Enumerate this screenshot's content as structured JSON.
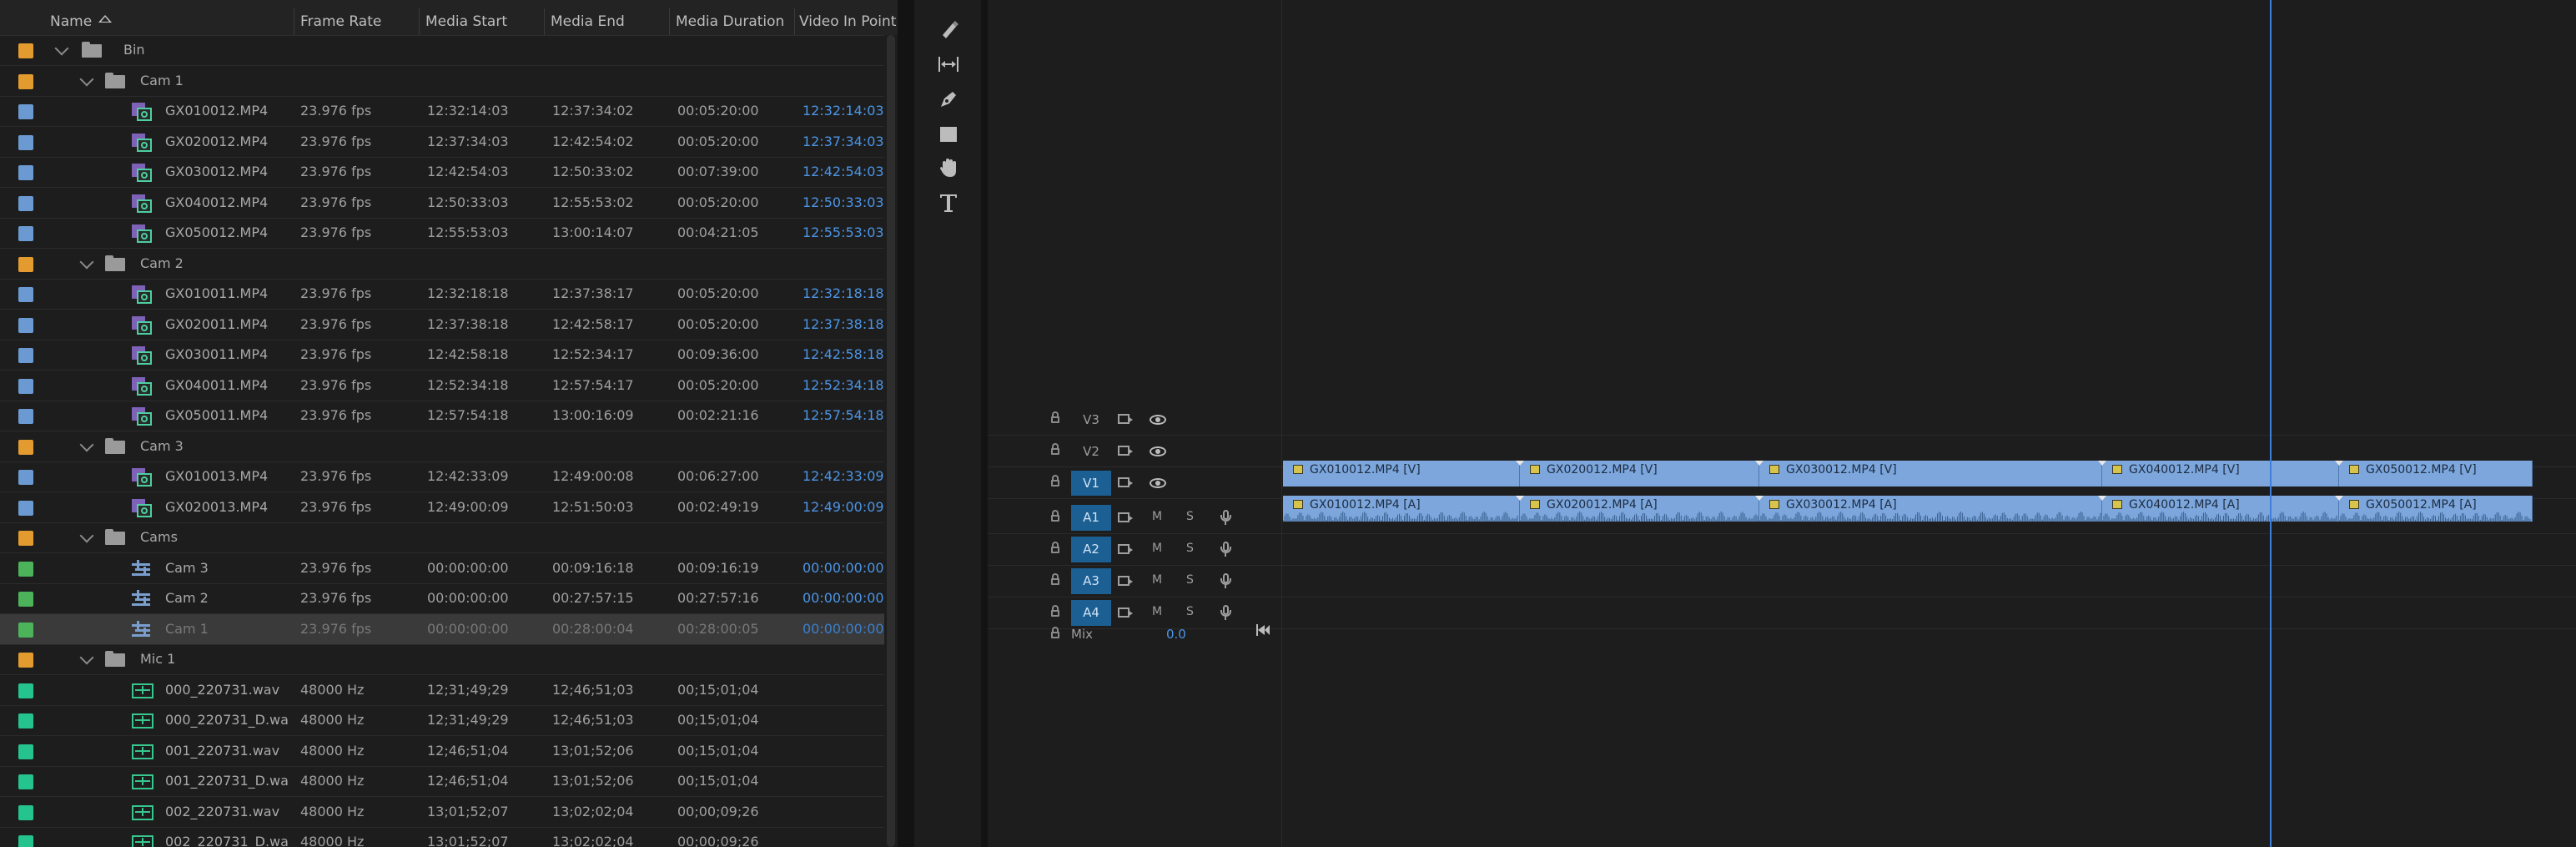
{
  "project": {
    "columns": {
      "name": "Name",
      "frame_rate": "Frame Rate",
      "media_start": "Media Start",
      "media_end": "Media End",
      "media_duration": "Media Duration",
      "video_in_point": "Video In Point"
    },
    "rows": [
      {
        "type": "folder",
        "level": 0,
        "name": "Bin",
        "label_color": "#e39b2f"
      },
      {
        "type": "folder",
        "level": 1,
        "name": "Cam 1",
        "label_color": "#e39b2f"
      },
      {
        "type": "clip",
        "level": 2,
        "name": "GX010012.MP4",
        "fr": "23.976 fps",
        "ms": "12:32:14:03",
        "me": "12:37:34:02",
        "md": "00:05:20:00",
        "vin": "12:32:14:03",
        "label_color": "#6b9ad3"
      },
      {
        "type": "clip",
        "level": 2,
        "name": "GX020012.MP4",
        "fr": "23.976 fps",
        "ms": "12:37:34:03",
        "me": "12:42:54:02",
        "md": "00:05:20:00",
        "vin": "12:37:34:03",
        "label_color": "#6b9ad3"
      },
      {
        "type": "clip",
        "level": 2,
        "name": "GX030012.MP4",
        "fr": "23.976 fps",
        "ms": "12:42:54:03",
        "me": "12:50:33:02",
        "md": "00:07:39:00",
        "vin": "12:42:54:03",
        "label_color": "#6b9ad3"
      },
      {
        "type": "clip",
        "level": 2,
        "name": "GX040012.MP4",
        "fr": "23.976 fps",
        "ms": "12:50:33:03",
        "me": "12:55:53:02",
        "md": "00:05:20:00",
        "vin": "12:50:33:03",
        "label_color": "#6b9ad3"
      },
      {
        "type": "clip",
        "level": 2,
        "name": "GX050012.MP4",
        "fr": "23.976 fps",
        "ms": "12:55:53:03",
        "me": "13:00:14:07",
        "md": "00:04:21:05",
        "vin": "12:55:53:03",
        "label_color": "#6b9ad3"
      },
      {
        "type": "folder",
        "level": 1,
        "name": "Cam 2",
        "label_color": "#e39b2f"
      },
      {
        "type": "clip",
        "level": 2,
        "name": "GX010011.MP4",
        "fr": "23.976 fps",
        "ms": "12:32:18:18",
        "me": "12:37:38:17",
        "md": "00:05:20:00",
        "vin": "12:32:18:18",
        "label_color": "#6b9ad3"
      },
      {
        "type": "clip",
        "level": 2,
        "name": "GX020011.MP4",
        "fr": "23.976 fps",
        "ms": "12:37:38:18",
        "me": "12:42:58:17",
        "md": "00:05:20:00",
        "vin": "12:37:38:18",
        "label_color": "#6b9ad3"
      },
      {
        "type": "clip",
        "level": 2,
        "name": "GX030011.MP4",
        "fr": "23.976 fps",
        "ms": "12:42:58:18",
        "me": "12:52:34:17",
        "md": "00:09:36:00",
        "vin": "12:42:58:18",
        "label_color": "#6b9ad3"
      },
      {
        "type": "clip",
        "level": 2,
        "name": "GX040011.MP4",
        "fr": "23.976 fps",
        "ms": "12:52:34:18",
        "me": "12:57:54:17",
        "md": "00:05:20:00",
        "vin": "12:52:34:18",
        "label_color": "#6b9ad3"
      },
      {
        "type": "clip",
        "level": 2,
        "name": "GX050011.MP4",
        "fr": "23.976 fps",
        "ms": "12:57:54:18",
        "me": "13:00:16:09",
        "md": "00:02:21:16",
        "vin": "12:57:54:18",
        "label_color": "#6b9ad3"
      },
      {
        "type": "folder",
        "level": 1,
        "name": "Cam 3",
        "label_color": "#e39b2f"
      },
      {
        "type": "clip",
        "level": 2,
        "name": "GX010013.MP4",
        "fr": "23.976 fps",
        "ms": "12:42:33:09",
        "me": "12:49:00:08",
        "md": "00:06:27:00",
        "vin": "12:42:33:09",
        "label_color": "#6b9ad3"
      },
      {
        "type": "clip",
        "level": 2,
        "name": "GX020013.MP4",
        "fr": "23.976 fps",
        "ms": "12:49:00:09",
        "me": "12:51:50:03",
        "md": "00:02:49:19",
        "vin": "12:49:00:09",
        "label_color": "#6b9ad3"
      },
      {
        "type": "folder",
        "level": 1,
        "name": "Cams",
        "label_color": "#e39b2f"
      },
      {
        "type": "seq",
        "level": 2,
        "name": "Cam 3",
        "fr": "23.976 fps",
        "ms": "00:00:00:00",
        "me": "00:09:16:18",
        "md": "00:09:16:19",
        "vin": "00:00:00:00",
        "label_color": "#4cb35a"
      },
      {
        "type": "seq",
        "level": 2,
        "name": "Cam 2",
        "fr": "23.976 fps",
        "ms": "00:00:00:00",
        "me": "00:27:57:15",
        "md": "00:27:57:16",
        "vin": "00:00:00:00",
        "label_color": "#4cb35a"
      },
      {
        "type": "seq",
        "level": 2,
        "name": "Cam 1",
        "fr": "23.976 fps",
        "ms": "00:00:00:00",
        "me": "00:28:00:04",
        "md": "00:28:00:05",
        "vin": "00:00:00:00",
        "label_color": "#4cb35a",
        "selected": true
      },
      {
        "type": "folder",
        "level": 1,
        "name": "Mic 1",
        "label_color": "#e39b2f"
      },
      {
        "type": "audio",
        "level": 2,
        "name": "000_220731.wav",
        "fr": "48000 Hz",
        "ms": "12;31;49;29",
        "me": "12;46;51;03",
        "md": "00;15;01;04",
        "vin": "",
        "label_color": "#25c38e"
      },
      {
        "type": "audio",
        "level": 2,
        "name": "000_220731_D.wa",
        "fr": "48000 Hz",
        "ms": "12;31;49;29",
        "me": "12;46;51;03",
        "md": "00;15;01;04",
        "vin": "",
        "label_color": "#25c38e"
      },
      {
        "type": "audio",
        "level": 2,
        "name": "001_220731.wav",
        "fr": "48000 Hz",
        "ms": "12;46;51;04",
        "me": "13;01;52;06",
        "md": "00;15;01;04",
        "vin": "",
        "label_color": "#25c38e"
      },
      {
        "type": "audio",
        "level": 2,
        "name": "001_220731_D.wa",
        "fr": "48000 Hz",
        "ms": "12;46;51;04",
        "me": "13;01;52;06",
        "md": "00;15;01;04",
        "vin": "",
        "label_color": "#25c38e"
      },
      {
        "type": "audio",
        "level": 2,
        "name": "002_220731.wav",
        "fr": "48000 Hz",
        "ms": "13;01;52;07",
        "me": "13;02;02;04",
        "md": "00;00;09;26",
        "vin": "",
        "label_color": "#25c38e"
      },
      {
        "type": "audio",
        "level": 2,
        "name": "002_220731_D.wa",
        "fr": "48000 Hz",
        "ms": "13;01;52;07",
        "me": "13;02;02;04",
        "md": "00;00;09;26",
        "vin": "",
        "label_color": "#25c38e"
      }
    ]
  },
  "tools": [
    "razor-tool-icon",
    "slip-tool-icon",
    "pen-tool-icon",
    "rectangle-tool-icon",
    "hand-tool-icon",
    "type-tool-icon"
  ],
  "timeline": {
    "video_tracks": [
      {
        "name": "V3",
        "active": false
      },
      {
        "name": "V2",
        "active": false
      },
      {
        "name": "V1",
        "active": true
      }
    ],
    "audio_tracks": [
      {
        "name": "A1",
        "active": true,
        "m": "M",
        "s": "S"
      },
      {
        "name": "A2",
        "active": true,
        "m": "M",
        "s": "S"
      },
      {
        "name": "A3",
        "active": true,
        "m": "M",
        "s": "S"
      },
      {
        "name": "A4",
        "active": true,
        "m": "M",
        "s": "S"
      }
    ],
    "mix": {
      "label": "Mix",
      "value": "0.0"
    },
    "video_clips": [
      "GX010012.MP4 [V]",
      "GX020012.MP4 [V]",
      "GX030012.MP4 [V]",
      "GX040012.MP4 [V]",
      "GX050012.MP4 [V]"
    ],
    "audio_clips": [
      "GX010012.MP4 [A]",
      "GX020012.MP4 [A]",
      "GX030012.MP4 [A]",
      "GX040012.MP4 [A]",
      "GX050012.MP4 [A]"
    ],
    "clip_color": "#7ca6dc",
    "playhead_color": "#3f7fdc"
  }
}
